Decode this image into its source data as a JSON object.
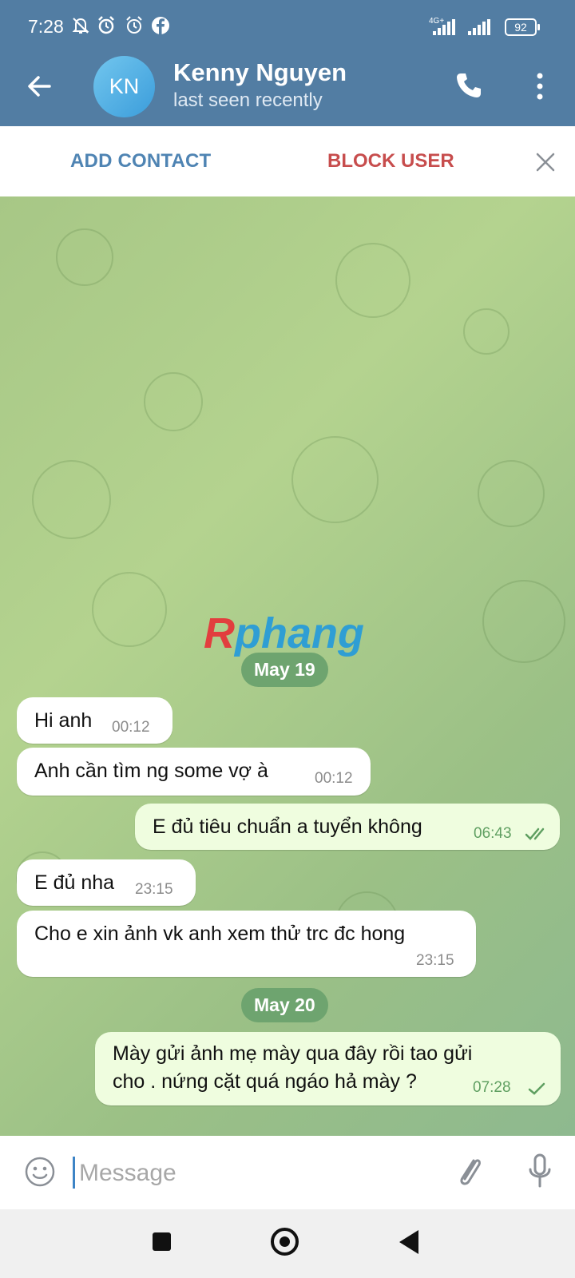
{
  "status_bar": {
    "time": "7:28",
    "network": "4G+",
    "battery": "92",
    "icons": [
      "mute-bell-icon",
      "alarm-icon",
      "alarm-outline-icon",
      "facebook-icon",
      "signal-icon",
      "battery-icon"
    ]
  },
  "header": {
    "avatar_initials": "KN",
    "name": "Kenny Nguyen",
    "status": "last seen recently",
    "accent": "#527da3"
  },
  "contact_actions": {
    "add_contact": "ADD CONTACT",
    "block_user": "BLOCK USER"
  },
  "watermark": {
    "first": "R",
    "rest": "phang"
  },
  "chat": {
    "dates": [
      "May 19",
      "May 20"
    ],
    "messages": [
      {
        "direction": "in",
        "text": "Hi anh",
        "time": "00:12"
      },
      {
        "direction": "in",
        "text": "Anh cần tìm ng some vợ à",
        "time": "00:12"
      },
      {
        "direction": "out",
        "text": "E đủ tiêu chuẩn a tuyển không",
        "time": "06:43",
        "status": "read"
      },
      {
        "direction": "in",
        "text": "E đủ nha",
        "time": "23:15"
      },
      {
        "direction": "in",
        "text": "Cho e xin ảnh vk anh xem thử trc đc hong",
        "time": "23:15"
      },
      {
        "direction": "out",
        "text_line1": "Mày gửi ảnh mẹ mày qua đây rồi tao gửi",
        "text_line2": "cho . nứng cặt quá ngáo hả mày ?",
        "time": "07:28",
        "status": "sent"
      }
    ]
  },
  "composer": {
    "placeholder": "Message"
  },
  "colors": {
    "chat_background": "#a7c786",
    "incoming_bubble": "#ffffff",
    "outgoing_bubble": "#effddf",
    "date_pill": "#6ea46f",
    "block_red": "#c74d4d"
  }
}
